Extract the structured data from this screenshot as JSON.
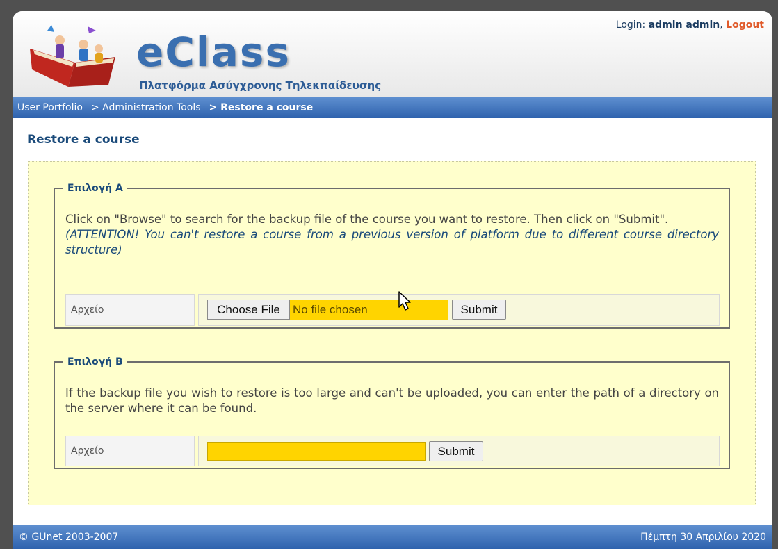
{
  "header": {
    "logo_title": "eClass",
    "logo_subtitle": "Πλατφόρμα Ασύγχρονης Τηλεκπαίδευσης",
    "login_label": "Login:",
    "user_name": "admin admin",
    "separator": ",",
    "logout_label": "Logout"
  },
  "breadcrumb": {
    "items": [
      "User Portfolio",
      "> Administration Tools"
    ],
    "current": "> Restore a course"
  },
  "page": {
    "title": "Restore a course"
  },
  "option_a": {
    "legend": "Επιλογή A",
    "description": "Click on \"Browse\" to search for the backup file of the course you want to restore. Then click on \"Submit\".",
    "attention": "(ATTENTION! You can't restore a course from a previous version of platform due to different course directory structure)",
    "field_label": "Αρχείο",
    "choose_file_label": "Choose File",
    "file_status": "No file chosen",
    "submit_label": "Submit"
  },
  "option_b": {
    "legend": "Επιλογή B",
    "description": "If the backup file you wish to restore is too large and can't be uploaded, you can enter the path of a directory on the server where it can be found.",
    "field_label": "Αρχείο",
    "path_value": "",
    "submit_label": "Submit"
  },
  "footer": {
    "copyright": "© GUnet 2003-2007",
    "date": "Πέμπτη 30 Απριλίου 2020"
  },
  "colors": {
    "accent_blue": "#2e62ad",
    "content_bg": "#ffffcc",
    "field_highlight": "#ffd400",
    "logout": "#e05a2a"
  }
}
